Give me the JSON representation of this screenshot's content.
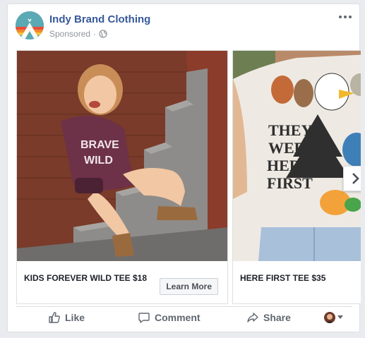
{
  "post": {
    "page_name": "Indy Brand Clothing",
    "sponsored_label": "Sponsored",
    "separator": "·"
  },
  "cards": [
    {
      "caption": "KIDS FOREVER WILD TEE $18",
      "cta_label": "Learn More",
      "shirt_text": "BRAVE WILD"
    },
    {
      "caption": "HERE FIRST TEE $35",
      "shirt_text": "THEY WERE HERE FIRST"
    }
  ],
  "actions": {
    "like": "Like",
    "comment": "Comment",
    "share": "Share"
  },
  "icons": {
    "avatar": "sunset-mountain-logo",
    "privacy": "globe-icon",
    "more": "more-options-icon",
    "next": "chevron-right-icon",
    "like": "thumbs-up-icon",
    "comment": "comment-bubble-icon",
    "share": "share-arrow-icon",
    "reactions": "reaction-picker-icon"
  },
  "colors": {
    "page_name": "#365899",
    "muted_text": "#90949c",
    "action_text": "#606770",
    "logo_teal": "#5ba9b4"
  }
}
